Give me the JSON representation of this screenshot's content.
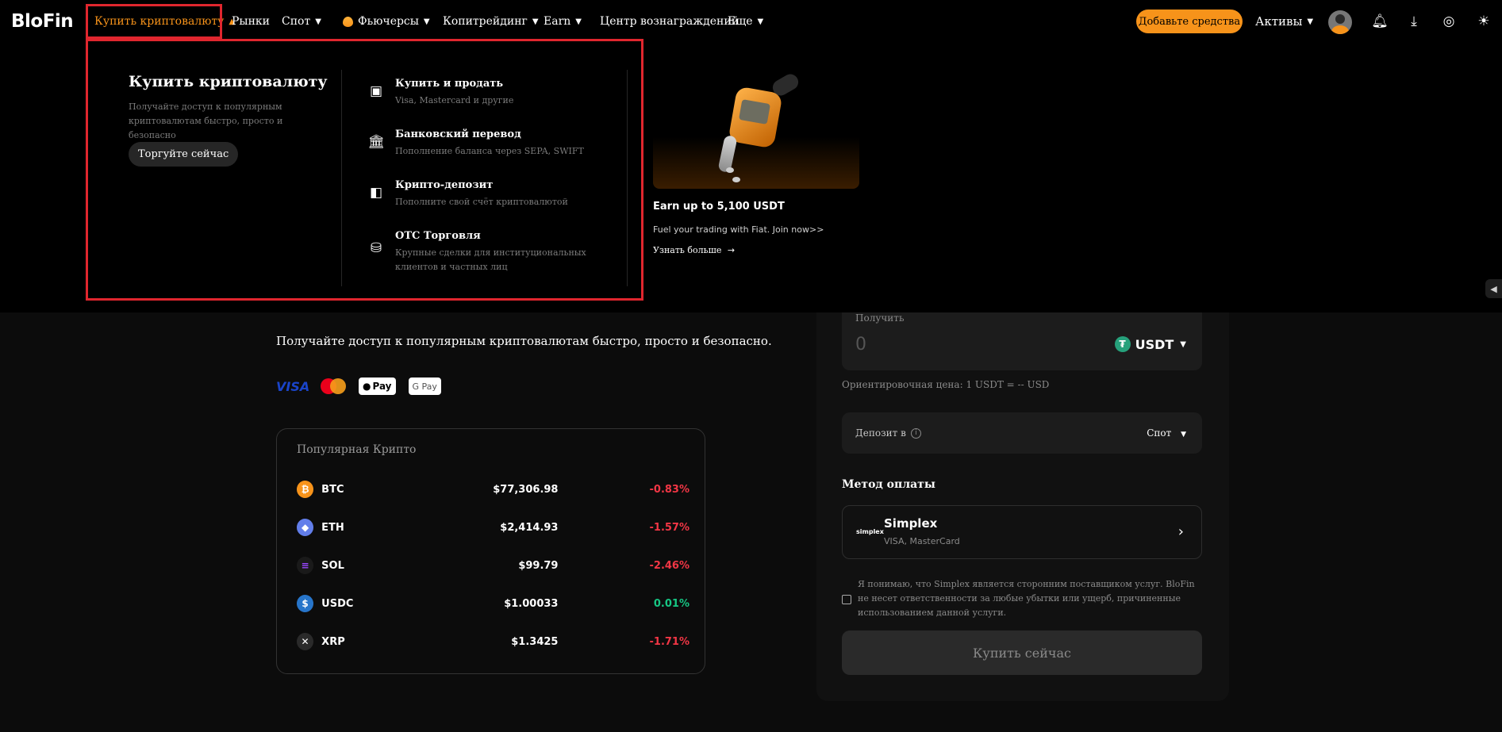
{
  "header": {
    "logo": "BloFin",
    "nav": [
      {
        "label": "Купить криптовалюту"
      },
      {
        "label": "Рынки"
      },
      {
        "label": "Спот"
      },
      {
        "label": "Фьючерсы"
      },
      {
        "label": "Копитрейдинг"
      },
      {
        "label": "Earn"
      },
      {
        "label": "Центр вознаграждений"
      },
      {
        "label": "Еще"
      }
    ],
    "deposit_btn": "Добавьте средства",
    "assets": "Активы",
    "icons": [
      "avatar-icon",
      "bell-icon",
      "download-icon",
      "globe-icon",
      "sun-icon"
    ]
  },
  "dropdown": {
    "title": "Купить криптовалюту",
    "desc": "Получайте доступ к популярным криптовалютам быстро, просто и безопасно",
    "cta": "Торгуйте сейчас",
    "items": [
      {
        "title": "Купить и продать",
        "sub": "Visa, Mastercard и другие",
        "icon": "card-icon"
      },
      {
        "title": "Банковский перевод",
        "sub": "Пополнение баланса через SEPA, SWIFT",
        "icon": "bank-icon"
      },
      {
        "title": "Крипто-депозит",
        "sub": "Пополните свой счёт криптовалютой",
        "icon": "wallet-icon"
      },
      {
        "title": "OTC Торговля",
        "sub": "Крупные сделки для институциональных клиентов и частных лиц",
        "icon": "coins-icon"
      }
    ],
    "promo": {
      "title": "Earn up to 5,100 USDT",
      "sub": "Fuel your trading with Fiat. Join now>>",
      "link": "Узнать больше"
    }
  },
  "page": {
    "intro": "Получайте доступ к популярным криптовалютам быстро, просто и безопасно.",
    "payment_logos": {
      "visa": "VISA",
      "apple": "Pay",
      "google": "G Pay"
    },
    "popular": {
      "title": "Популярная Крипто",
      "rows": [
        {
          "symbol": "BTC",
          "price": "$77,306.98",
          "change": "-0.83%",
          "dir": "neg",
          "color": "#f7931a",
          "glyph": "₿"
        },
        {
          "symbol": "ETH",
          "price": "$2,414.93",
          "change": "-1.57%",
          "dir": "neg",
          "color": "#627eea",
          "glyph": "◆"
        },
        {
          "symbol": "SOL",
          "price": "$99.79",
          "change": "-2.46%",
          "dir": "neg",
          "color": "#1a1a1a",
          "glyph": "≡"
        },
        {
          "symbol": "USDC",
          "price": "$1.00033",
          "change": "0.01%",
          "dir": "pos",
          "color": "#2775ca",
          "glyph": "$"
        },
        {
          "symbol": "XRP",
          "price": "$1.3425",
          "change": "-1.71%",
          "dir": "neg",
          "color": "#2a2a2a",
          "glyph": "✕"
        }
      ]
    }
  },
  "form": {
    "receive_label": "Получить",
    "receive_value": "0",
    "receive_currency": "USDT",
    "estimate": "Ориентировочная цена: 1 USDT = -- USD",
    "deposit_label": "Депозит в",
    "deposit_value": "Спот",
    "method_title": "Метод оплаты",
    "method": {
      "logo": "simplex",
      "name": "Simplex",
      "sub": "VISA, MasterCard"
    },
    "agreement": "Я понимаю, что Simplex является сторонним поставщиком услуг. BloFin не несет ответственности за любые убытки или ущерб, причиненные использованием данной услуги.",
    "buy_button": "Купить сейчас"
  },
  "colors": {
    "accent": "#f7931a",
    "highlight": "#e0262e",
    "negative": "#f23645",
    "positive": "#16c784"
  }
}
